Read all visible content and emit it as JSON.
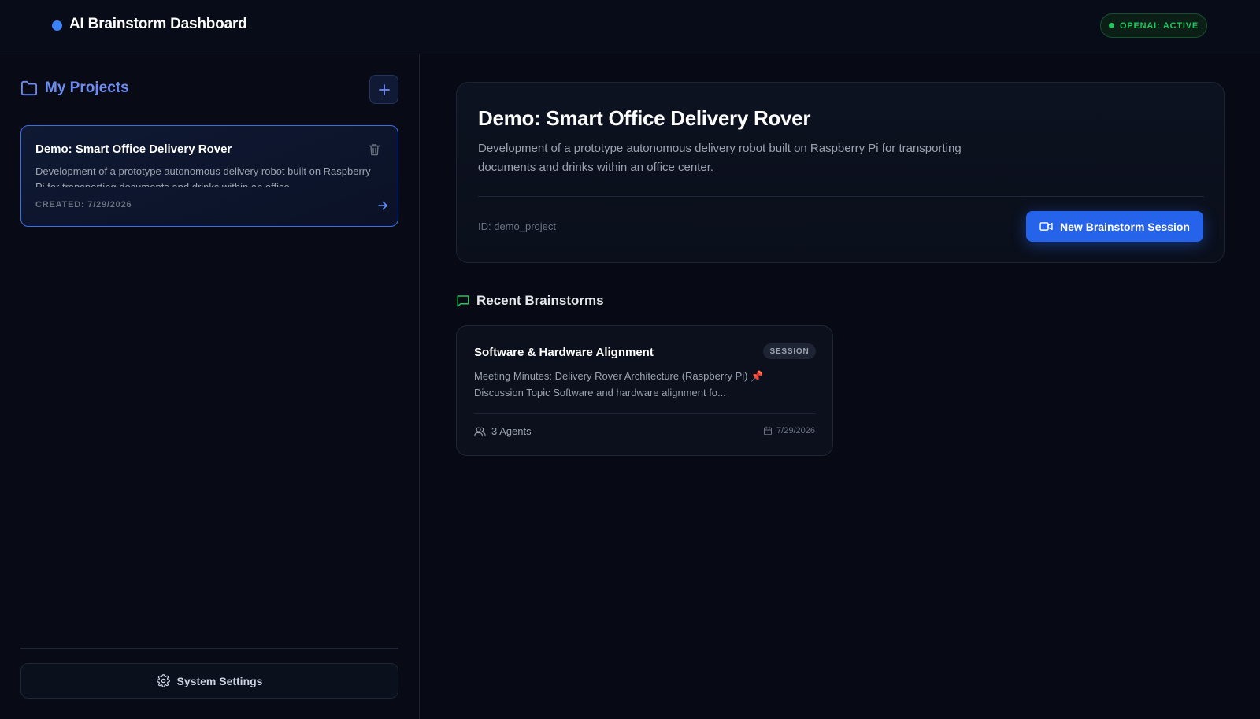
{
  "header": {
    "title": "AI Brainstorm Dashboard",
    "status_badge": "OPENAI: ACTIVE"
  },
  "sidebar": {
    "title": "My Projects",
    "projects": [
      {
        "title": "Demo: Smart Office Delivery Rover",
        "description": "Development of a prototype autonomous delivery robot built on Raspberry Pi for transporting documents and drinks within an office...",
        "created": "CREATED: 7/29/2026"
      }
    ],
    "settings_label": "System Settings"
  },
  "project": {
    "title": "Demo: Smart Office Delivery Rover",
    "description": "Development of a prototype autonomous delivery robot built on Raspberry Pi for transporting documents and drinks within an office center.",
    "id_label": "ID: demo_project",
    "new_session_label": "New Brainstorm Session"
  },
  "recent": {
    "title": "Recent Brainstorms",
    "sessions": [
      {
        "title": "Software & Hardware Alignment",
        "badge": "SESSION",
        "desc_line1": "Meeting Minutes: Delivery Rover Architecture (Raspberry Pi) 📌",
        "desc_line2": "Discussion Topic Software and hardware alignment fo...",
        "agents": "3 Agents",
        "date": "7/29/2026"
      }
    ]
  },
  "colors": {
    "accent": "#3b82f6",
    "primary_button": "#2563eb",
    "status_green": "#22c55e",
    "sidebar_title": "#6d8cf2"
  },
  "icons": [
    "folder-icon",
    "plus-icon",
    "trash-icon",
    "arrow-right-icon",
    "gear-icon",
    "video-camera-icon",
    "message-icon",
    "users-icon",
    "calendar-icon"
  ]
}
